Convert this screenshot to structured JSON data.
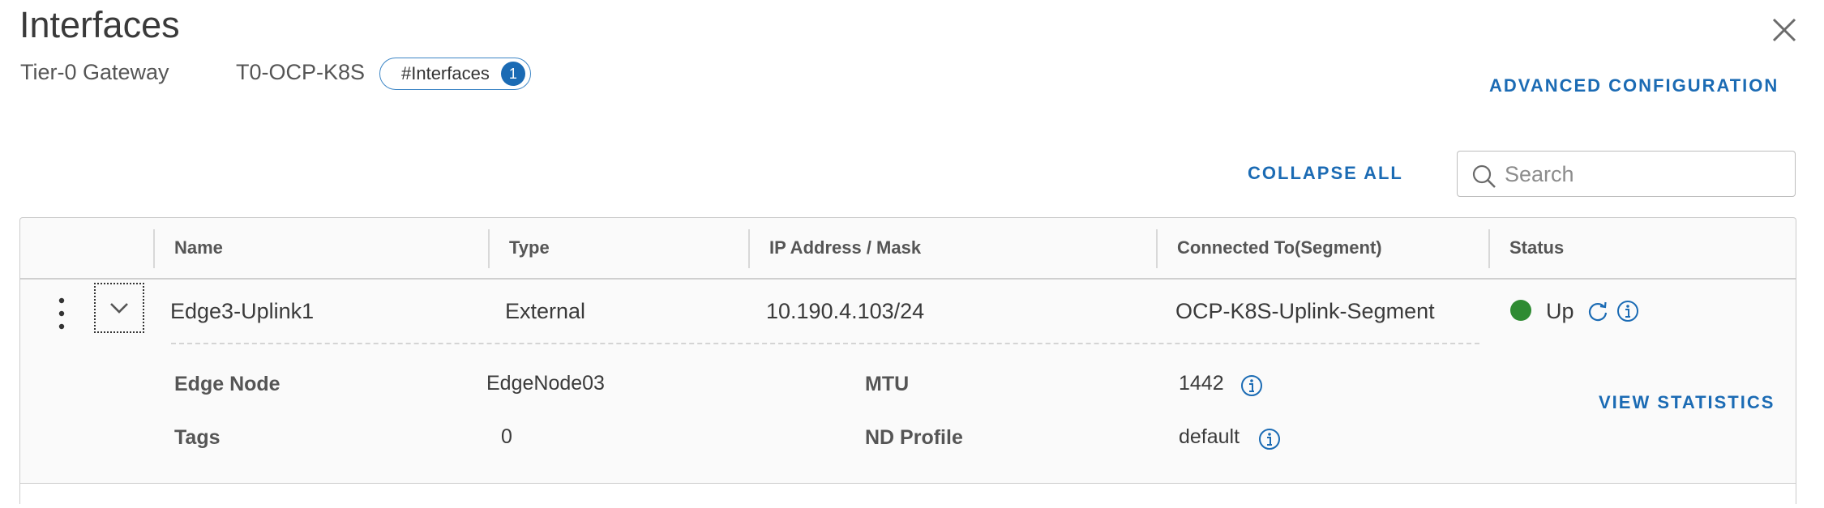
{
  "header": {
    "title": "Interfaces",
    "gateway_type": "Tier-0 Gateway",
    "gateway_name": "T0-OCP-K8S",
    "interfaces_label": "#Interfaces",
    "interfaces_count": "1",
    "advanced_link": "ADVANCED CONFIGURATION"
  },
  "toolbar": {
    "collapse_all": "COLLAPSE ALL",
    "search_placeholder": "Search"
  },
  "table": {
    "columns": [
      "Name",
      "Type",
      "IP Address / Mask",
      "Connected To(Segment)",
      "Status"
    ],
    "rows": [
      {
        "name": "Edge3-Uplink1",
        "type": "External",
        "ip": "10.190.4.103/24",
        "segment": "OCP-K8S-Uplink-Segment",
        "status": "Up",
        "details": {
          "edge_node_label": "Edge Node",
          "edge_node_value": "EdgeNode03",
          "mtu_label": "MTU",
          "mtu_value": "1442",
          "tags_label": "Tags",
          "tags_value": "0",
          "nd_profile_label": "ND Profile",
          "nd_profile_value": "default",
          "view_statistics": "VIEW STATISTICS"
        }
      }
    ]
  },
  "colors": {
    "accent": "#1b6bb4",
    "status_up": "#2e8b32"
  },
  "icons": [
    "close-icon",
    "search-icon",
    "kebab-menu-icon",
    "chevron-down-icon",
    "refresh-icon",
    "info-icon"
  ]
}
